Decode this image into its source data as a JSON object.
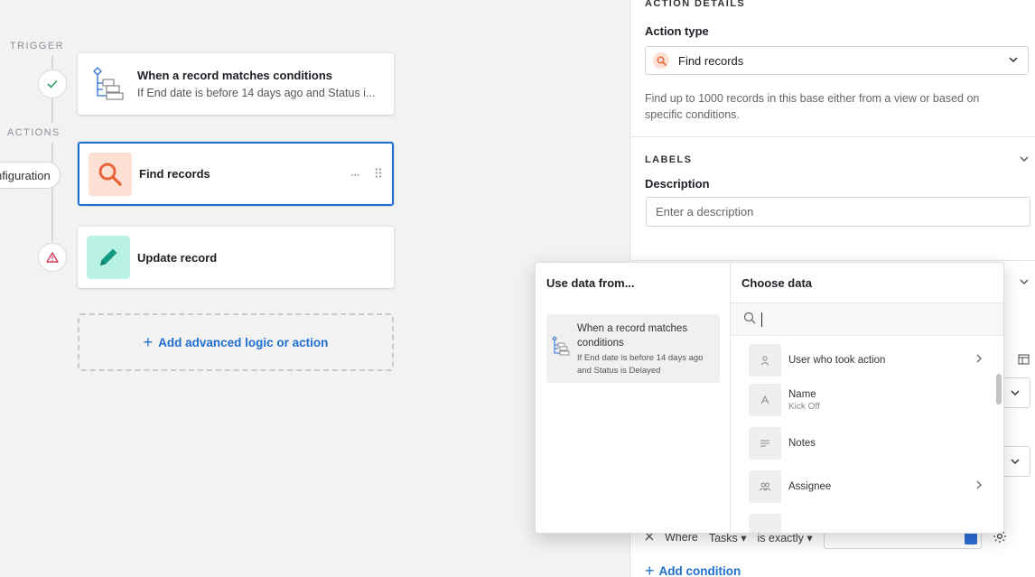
{
  "canvas": {
    "trigger_label": "TRIGGER",
    "actions_label": "ACTIONS",
    "config_pill": "nfiguration",
    "trigger_card": {
      "title": "When a record matches conditions",
      "subtitle": "If End date is before 14 days ago and Status i..."
    },
    "find_card": {
      "title": "Find records",
      "more": "···",
      "drag": "⠿"
    },
    "update_card": {
      "title": "Update record"
    },
    "add_logic": {
      "plus": "+",
      "label": "Add advanced logic or action"
    }
  },
  "panel": {
    "section_title": "ACTION DETAILS",
    "action_type_label": "Action type",
    "action_type_value": "Find records",
    "action_type_desc": "Find up to 1000 records in this base either from a view or based on specific conditions.",
    "labels_section": "LABELS",
    "description_label": "Description",
    "description_placeholder": "Enter a description"
  },
  "popup": {
    "left_header": "Use data from...",
    "source": {
      "title": "When a record matches conditions",
      "subtitle": "If End date is before 14 days ago and Status is Delayed"
    },
    "right_header": "Choose data",
    "fields": [
      {
        "name": "User who took action",
        "value": "",
        "has_chevron": true,
        "icon": "user-icon"
      },
      {
        "name": "Name",
        "value": "Kick Off",
        "has_chevron": false,
        "icon": "text-icon"
      },
      {
        "name": "Notes",
        "value": "",
        "has_chevron": false,
        "icon": "long-text-icon"
      },
      {
        "name": "Assignee",
        "value": "",
        "has_chevron": true,
        "icon": "users-icon"
      }
    ]
  },
  "conditions": {
    "where": "Where",
    "field": "Tasks",
    "operator": "is exactly",
    "add_condition_plus": "+",
    "add_condition": "Add condition"
  },
  "colors": {
    "accent_blue": "#1f6fd1",
    "find_icon_bg": "#fde0d4",
    "find_icon_fg": "#e8643a",
    "update_icon_bg": "#b9f1e4",
    "update_icon_fg": "#139a82"
  }
}
